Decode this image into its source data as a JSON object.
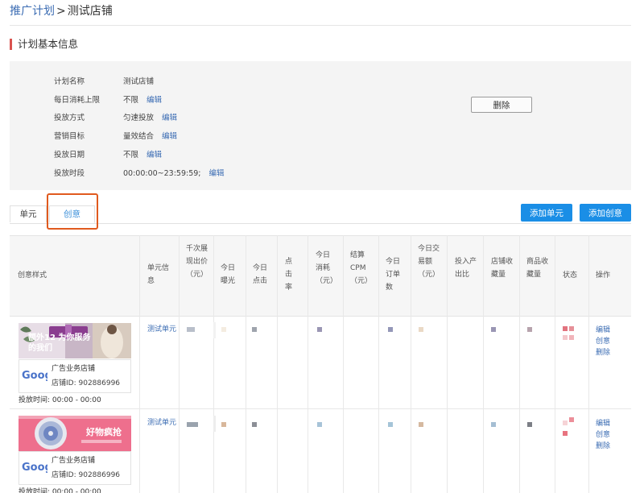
{
  "breadcrumb": {
    "parent": "推广计划",
    "separator": ">",
    "current": "测试店铺"
  },
  "section_title": "计划基本信息",
  "plan": {
    "rows": [
      {
        "label": "计划名称",
        "value": "测试店铺",
        "edit": ""
      },
      {
        "label": "每日消耗上限",
        "value": "不限",
        "edit": "编辑"
      },
      {
        "label": "投放方式",
        "value": "匀速投放",
        "edit": "编辑"
      },
      {
        "label": "营销目标",
        "value": "量效结合",
        "edit": "编辑"
      },
      {
        "label": "投放日期",
        "value": "不限",
        "edit": "编辑"
      },
      {
        "label": "投放时段",
        "value": "00:00:00~23:59:59;",
        "edit": "编辑"
      }
    ],
    "delete_label": "删除"
  },
  "tabs": [
    {
      "label": "单元"
    },
    {
      "label": "创意",
      "active": true
    }
  ],
  "actions": {
    "add_unit": "添加单元",
    "add_creative": "添加创意"
  },
  "table": {
    "columns": [
      "创意样式",
      "单元信息",
      "千次展现出价（元）",
      "今日曝光",
      "今日点击",
      "点击率",
      "今日消耗（元）",
      "结算CPM（元）",
      "今日订单数",
      "今日交易额（元）",
      "投入产出比",
      "店铺收藏量",
      "商品收藏量",
      "状态",
      "操作"
    ],
    "rows": [
      {
        "banner_text": "额外12 为你服务的我们",
        "banner_theme": "purple-gift",
        "logo": "Goog",
        "shop_name": "广告业务店铺",
        "shop_id_label": "店铺ID:",
        "shop_id": "902886996",
        "schedule": "投放时间: 00:00 - 00:00",
        "unit": "测试单元",
        "ops": [
          "编辑",
          "创意",
          "删除"
        ]
      },
      {
        "banner_text": "好物疯抢",
        "banner_theme": "pink-fan",
        "logo": "Goog",
        "shop_name": "广告业务店铺",
        "shop_id_label": "店铺ID:",
        "shop_id": "902886996",
        "schedule": "投放时间: 00:00 - 00:00",
        "unit": "测试单元",
        "ops": [
          "编辑",
          "创意",
          "删除"
        ]
      }
    ]
  },
  "colors": {
    "link": "#3b6cb3",
    "primary_button": "#1a8ee6",
    "highlight_box": "#e05a1e",
    "section_accent": "#d9534f"
  }
}
